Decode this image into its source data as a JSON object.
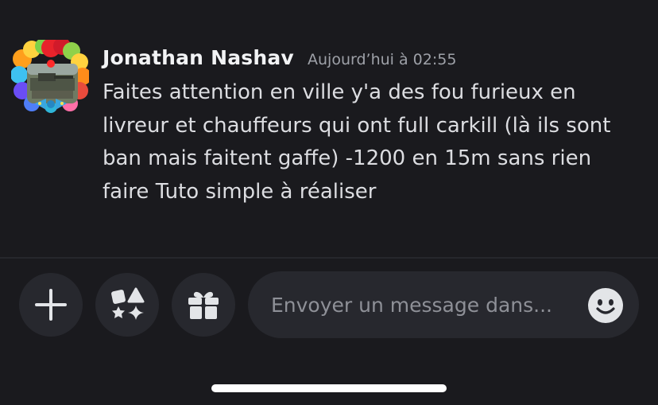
{
  "message": {
    "author": "Jonathan Nashav",
    "timestamp": "Aujourd’hui à 02:55",
    "content": "Faites attention en ville y'a des fou furieux en livreur et chauffeurs qui ont full carkill (là ils sont ban mais faitent gaffe) -1200 en 15m sans rien faire Tuto simple à réaliser",
    "avatar_icon": "avatar-clown-wig-icon"
  },
  "composer": {
    "placeholder": "Envoyer un message dans...",
    "value": ""
  },
  "actions": [
    {
      "name": "add-attachment-button",
      "icon": "plus-icon"
    },
    {
      "name": "apps-button",
      "icon": "shapes-icon"
    },
    {
      "name": "gift-button",
      "icon": "gift-icon"
    }
  ],
  "colors": {
    "background": "#1a1a1e",
    "button_surface": "#27282e",
    "author_text": "#f2f3f5",
    "body_text": "#dcdde1",
    "muted_text": "#9ea1a8",
    "icon": "#e3e5e8"
  }
}
